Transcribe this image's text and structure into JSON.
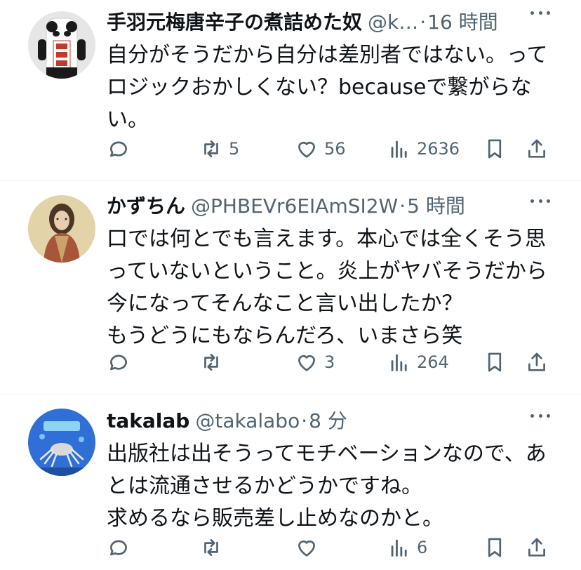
{
  "tweets": [
    {
      "name": "手羽元梅唐辛子の煮詰めた奴",
      "handle": "@k…",
      "time": "16 時間",
      "text": "自分がそうだから自分は差別者ではない。って\nロジックおかしくない？becauseで繋がらな\nい。",
      "replies": "",
      "retweets": "5",
      "likes": "56",
      "views": "2636",
      "avatar": "panda-tofu-avatar"
    },
    {
      "name": "かずちん",
      "handle": "@PHBEVr6EIAmSI2W",
      "time": "5 時間",
      "text": "口では何とでも言えます。本心では全くそう思\nっていないということ。炎上がヤバそうだから\n今になってそんなこと言い出したか？\nもうどうにもならんだろ、いまさら笑",
      "replies": "",
      "retweets": "",
      "likes": "3",
      "views": "264",
      "avatar": "portrait-painting-avatar"
    },
    {
      "name": "takalab",
      "handle": "@takalabo",
      "time": "8 分",
      "text": "出版社は出そうってモチベーションなので、あ\nとは流通させるかどうかですね。\n求めるなら販売差し止めなのかと。",
      "replies": "",
      "retweets": "",
      "likes": "",
      "views": "6",
      "avatar": "robot-crab-avatar"
    }
  ],
  "colors": {
    "text": "#0f1419",
    "secondary": "#536471",
    "divider": "#eff3f4"
  }
}
